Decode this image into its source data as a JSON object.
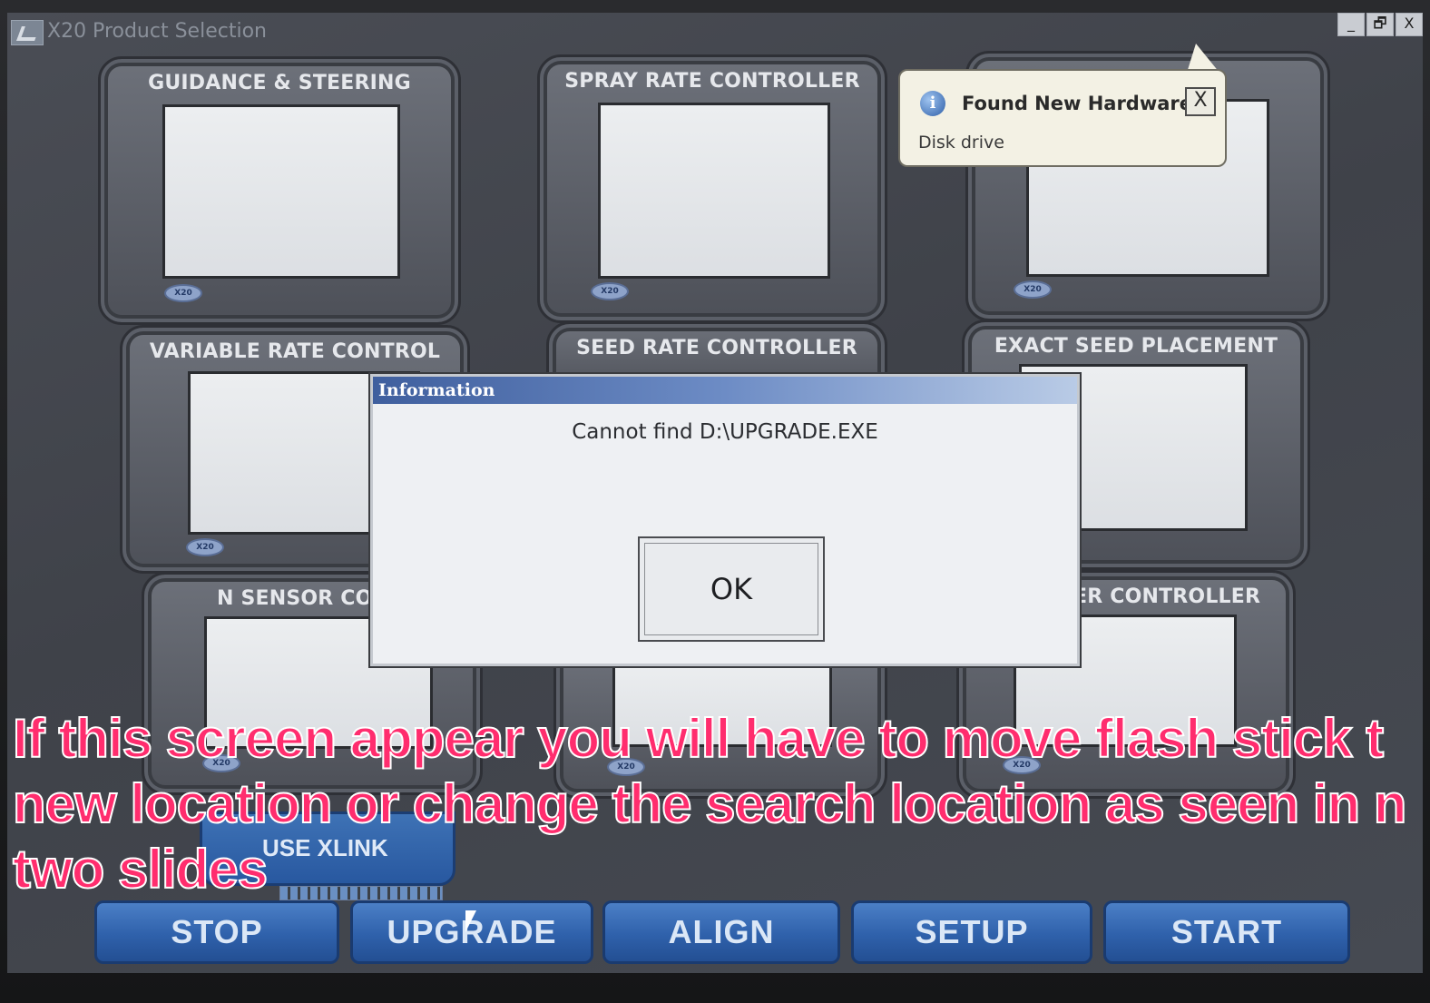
{
  "window": {
    "title": "X20 Product Selection",
    "buttons": [
      "_",
      "🗗",
      "X"
    ]
  },
  "tiles": [
    {
      "label": "GUIDANCE & STEERING",
      "badge": "X20"
    },
    {
      "label": "SPRAY RATE CONTROLLER",
      "badge": "X20"
    },
    {
      "label": "",
      "badge": "X20"
    },
    {
      "label": "VARIABLE RATE CONTROL",
      "badge": "X20"
    },
    {
      "label": "SEED RATE CONTROLLER",
      "badge": ""
    },
    {
      "label": "EXACT SEED PLACEMENT",
      "badge": ""
    },
    {
      "label": "N SENSOR CONTR",
      "badge": "X20"
    },
    {
      "label": "",
      "badge": "X20"
    },
    {
      "label": "ER CONTROLLER",
      "badge": "X20"
    }
  ],
  "notification": {
    "title": "Found New Hardware",
    "body": "Disk drive",
    "close": "X",
    "icon": "info-icon"
  },
  "dialog": {
    "title": "Information",
    "message": "Cannot find D:\\UPGRADE.EXE",
    "ok_label": "OK"
  },
  "xlink": {
    "label": "USE XLINK"
  },
  "nav": {
    "stop": "STOP",
    "upgrade": "UPGRADE",
    "align": "ALIGN",
    "setup": "SETUP",
    "start": "START"
  },
  "caption": "If this screen appear you will have to move flash stick t\nnew location or change the search location as seen in n\ntwo slides",
  "colors": {
    "caption": "#ff2d6e",
    "nav_button": "#2f61ab",
    "dialog_title": "#3f5f9e"
  }
}
